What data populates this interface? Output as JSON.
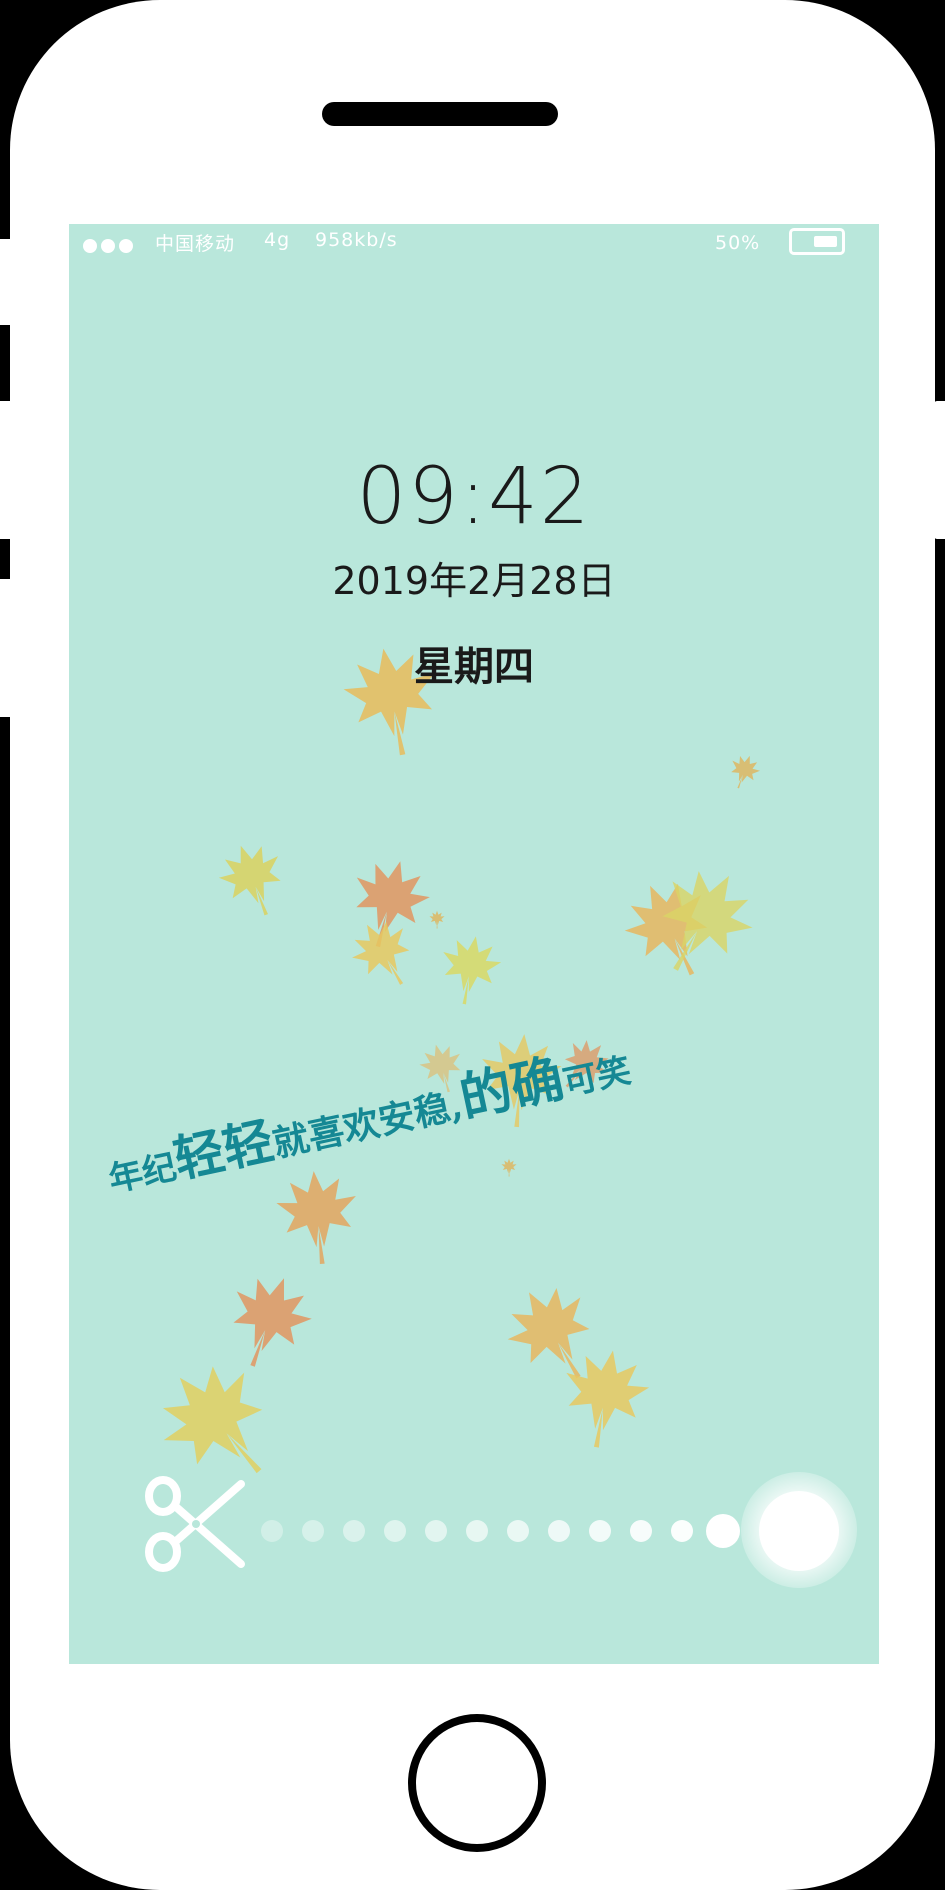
{
  "status_bar": {
    "carrier": "中国移动",
    "network": "4g",
    "speed": "958kb/s",
    "battery_percent": "50%",
    "battery_level": 0.5
  },
  "lock_screen": {
    "time": "09:42",
    "date": "2019年2月28日",
    "weekday": "星期四",
    "quote": {
      "part1": "年纪",
      "part2": "轻轻",
      "part3": "就喜欢安稳,",
      "part4": "的确",
      "part5": "可笑"
    }
  },
  "unlock": {
    "icon": "scissors-icon",
    "track_dots": 12
  },
  "colors": {
    "screen_bg": "#b9e7db",
    "quote": "#158894",
    "leaf_yellow": "#e7c765",
    "leaf_orange": "#e0975f",
    "leaf_green_yellow": "#d9d565"
  }
}
